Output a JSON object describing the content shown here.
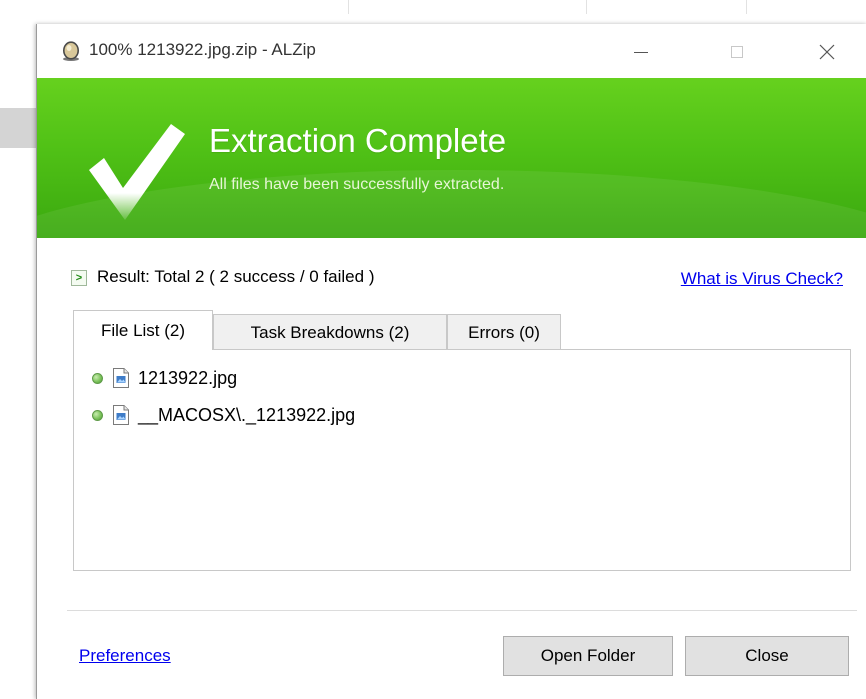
{
  "window": {
    "title": "100% 1213922.jpg.zip - ALZip"
  },
  "banner": {
    "title": "Extraction Complete",
    "subtitle": "All files have been successfully extracted."
  },
  "result": {
    "text": "Result: Total 2 ( 2 success / 0 failed )",
    "virus_link": "What is Virus Check?"
  },
  "tabs": [
    {
      "label": "File List (2)",
      "active": true
    },
    {
      "label": "Task Breakdowns (2)",
      "active": false
    },
    {
      "label": "Errors (0)",
      "active": false
    }
  ],
  "files": [
    {
      "name": "1213922.jpg",
      "status": "success"
    },
    {
      "name": "__MACOSX\\._1213922.jpg",
      "status": "success"
    }
  ],
  "footer": {
    "preferences_link": "Preferences",
    "open_folder_label": "Open Folder",
    "close_label": "Close"
  },
  "icons": {
    "app": "alzip-icon",
    "banner": "checkmark-icon",
    "result": "chevron-right-icon",
    "file": "image-file-icon",
    "status": "status-dot-icon"
  },
  "colors": {
    "banner_green": "#50c116",
    "link_blue": "#0000ee",
    "status_green": "#7cc35c"
  }
}
